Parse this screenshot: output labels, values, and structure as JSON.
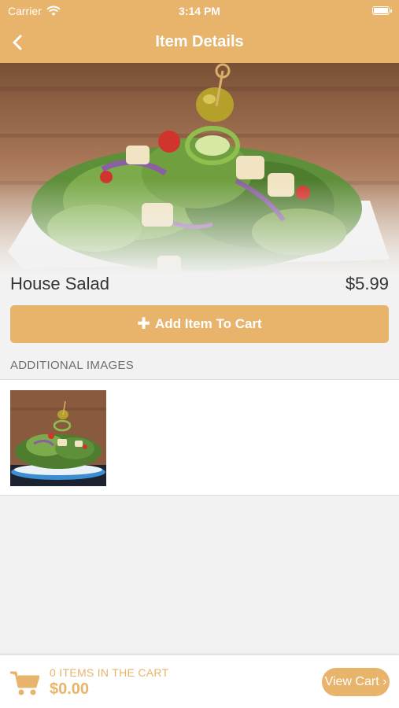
{
  "status_bar": {
    "carrier": "Carrier",
    "time": "3:14 PM"
  },
  "nav": {
    "title": "Item Details"
  },
  "item": {
    "name": "House Salad",
    "price": "$5.99"
  },
  "actions": {
    "add_to_cart_label": "Add Item To Cart"
  },
  "additional_images": {
    "header": "ADDITIONAL IMAGES"
  },
  "cart": {
    "count_label": "0 ITEMS IN THE CART",
    "total": "$0.00",
    "view_cart_label": "View Cart ›"
  },
  "colors": {
    "accent": "#e8b36b",
    "background": "#f2f2f2"
  },
  "icons": {
    "back": "chevron-left-icon",
    "wifi": "wifi-icon",
    "battery": "battery-icon",
    "add": "plus-icon",
    "cart": "cart-icon"
  }
}
